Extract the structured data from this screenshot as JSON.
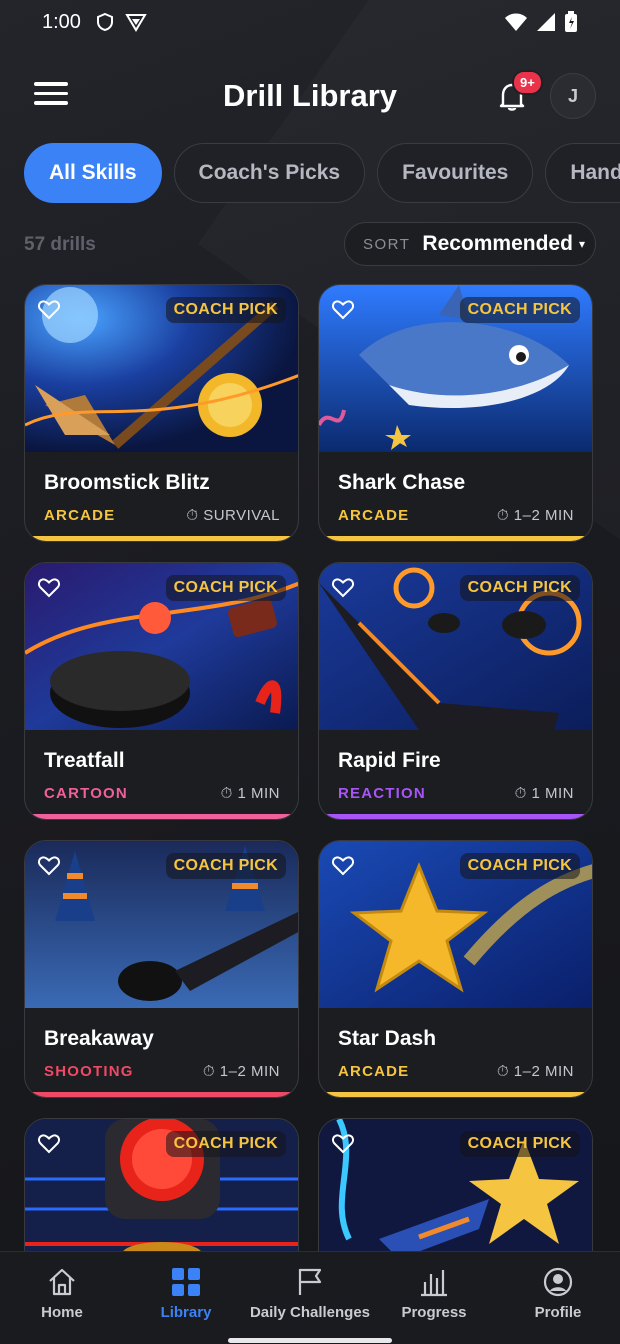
{
  "status_bar": {
    "time": "1:00"
  },
  "header": {
    "title": "Drill Library",
    "notification_badge": "9+",
    "avatar_initial": "J"
  },
  "chips": [
    {
      "label": "All Skills",
      "active": true
    },
    {
      "label": "Coach's Picks",
      "active": false
    },
    {
      "label": "Favourites",
      "active": false
    },
    {
      "label": "Hand",
      "active": false
    }
  ],
  "list_meta": {
    "count": "57 drills",
    "sort_label": "SORT",
    "sort_value": "Recommended"
  },
  "drills": [
    {
      "name": "Broomstick Blitz",
      "category": "ARCADE",
      "duration": "SURVIVAL",
      "badge": "COACH PICK",
      "accent": "#f5c542"
    },
    {
      "name": "Shark Chase",
      "category": "ARCADE",
      "duration": "1–2 MIN",
      "badge": "COACH PICK",
      "accent": "#f5c542"
    },
    {
      "name": "Treatfall",
      "category": "CARTOON",
      "duration": "1 MIN",
      "badge": "COACH PICK",
      "accent": "#f0609a"
    },
    {
      "name": "Rapid Fire",
      "category": "REACTION",
      "duration": "1 MIN",
      "badge": "COACH PICK",
      "accent": "#a855f7"
    },
    {
      "name": "Breakaway",
      "category": "SHOOTING",
      "duration": "1–2 MIN",
      "badge": "COACH PICK",
      "accent": "#ef4a65"
    },
    {
      "name": "Star Dash",
      "category": "ARCADE",
      "duration": "1–2 MIN",
      "badge": "COACH PICK",
      "accent": "#f5c542"
    },
    {
      "name": "",
      "category": "",
      "duration": "",
      "badge": "COACH PICK",
      "accent": "#f5c542"
    },
    {
      "name": "",
      "category": "",
      "duration": "",
      "badge": "COACH PICK",
      "accent": "#f5c542"
    }
  ],
  "nav": [
    {
      "label": "Home",
      "icon": "home-icon"
    },
    {
      "label": "Library",
      "icon": "grid-icon",
      "active": true
    },
    {
      "label": "Daily Challenges",
      "icon": "flag-icon"
    },
    {
      "label": "Progress",
      "icon": "bar-chart-icon"
    },
    {
      "label": "Profile",
      "icon": "person-icon"
    }
  ],
  "colors": {
    "accent_blue": "#3b82f6",
    "coach_pick_gold": "#f5c542",
    "badge_red": "#e8334a"
  }
}
